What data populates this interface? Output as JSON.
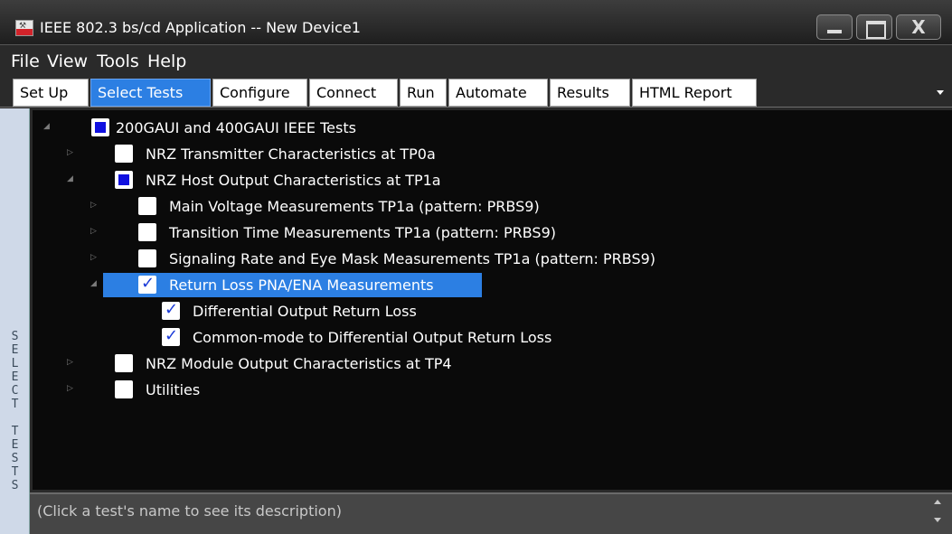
{
  "window": {
    "title": "IEEE 802.3 bs/cd Application -- New Device1",
    "close_glyph": "X"
  },
  "menu": {
    "items": [
      "File",
      "View",
      "Tools",
      "Help"
    ]
  },
  "tabs": [
    {
      "label": "Set Up",
      "active": false
    },
    {
      "label": "Select Tests",
      "active": true
    },
    {
      "label": "Configure",
      "active": false
    },
    {
      "label": "Connect",
      "active": false
    },
    {
      "label": "Run",
      "active": false
    },
    {
      "label": "Automate",
      "active": false
    },
    {
      "label": "Results",
      "active": false
    },
    {
      "label": "HTML Report",
      "active": false
    }
  ],
  "side_panel": {
    "letters": [
      "S",
      "E",
      "L",
      "E",
      "C",
      "T",
      "",
      "T",
      "E",
      "S",
      "T",
      "S"
    ]
  },
  "tree": [
    {
      "label": "200GAUI and 400GAUI IEEE Tests",
      "state": "partial",
      "expanded": true,
      "selected": false
    },
    {
      "label": "NRZ Transmitter Characteristics at TP0a",
      "state": "unchecked",
      "expanded": false,
      "selected": false
    },
    {
      "label": "NRZ Host Output Characteristics at TP1a",
      "state": "partial",
      "expanded": true,
      "selected": false
    },
    {
      "label": "Main Voltage Measurements TP1a (pattern: PRBS9)",
      "state": "unchecked",
      "expanded": false,
      "selected": false
    },
    {
      "label": "Transition Time Measurements TP1a (pattern: PRBS9)",
      "state": "unchecked",
      "expanded": false,
      "selected": false
    },
    {
      "label": "Signaling Rate and Eye Mask Measurements TP1a (pattern: PRBS9)",
      "state": "unchecked",
      "expanded": false,
      "selected": false
    },
    {
      "label": "Return Loss PNA/ENA Measurements",
      "state": "checked",
      "expanded": true,
      "selected": true
    },
    {
      "label": "Differential Output Return Loss",
      "state": "checked",
      "expanded": null,
      "selected": false
    },
    {
      "label": "Common-mode to Differential Output Return Loss",
      "state": "checked",
      "expanded": null,
      "selected": false
    },
    {
      "label": "NRZ Module Output Characteristics at TP4",
      "state": "unchecked",
      "expanded": false,
      "selected": false
    },
    {
      "label": "Utilities",
      "state": "unchecked",
      "expanded": false,
      "selected": false
    }
  ],
  "description": {
    "text": "(Click a test's name to see its description)"
  },
  "colors": {
    "accent": "#2c7fe3",
    "partial_fill": "#1010e0",
    "check": "#1a3ad8"
  }
}
